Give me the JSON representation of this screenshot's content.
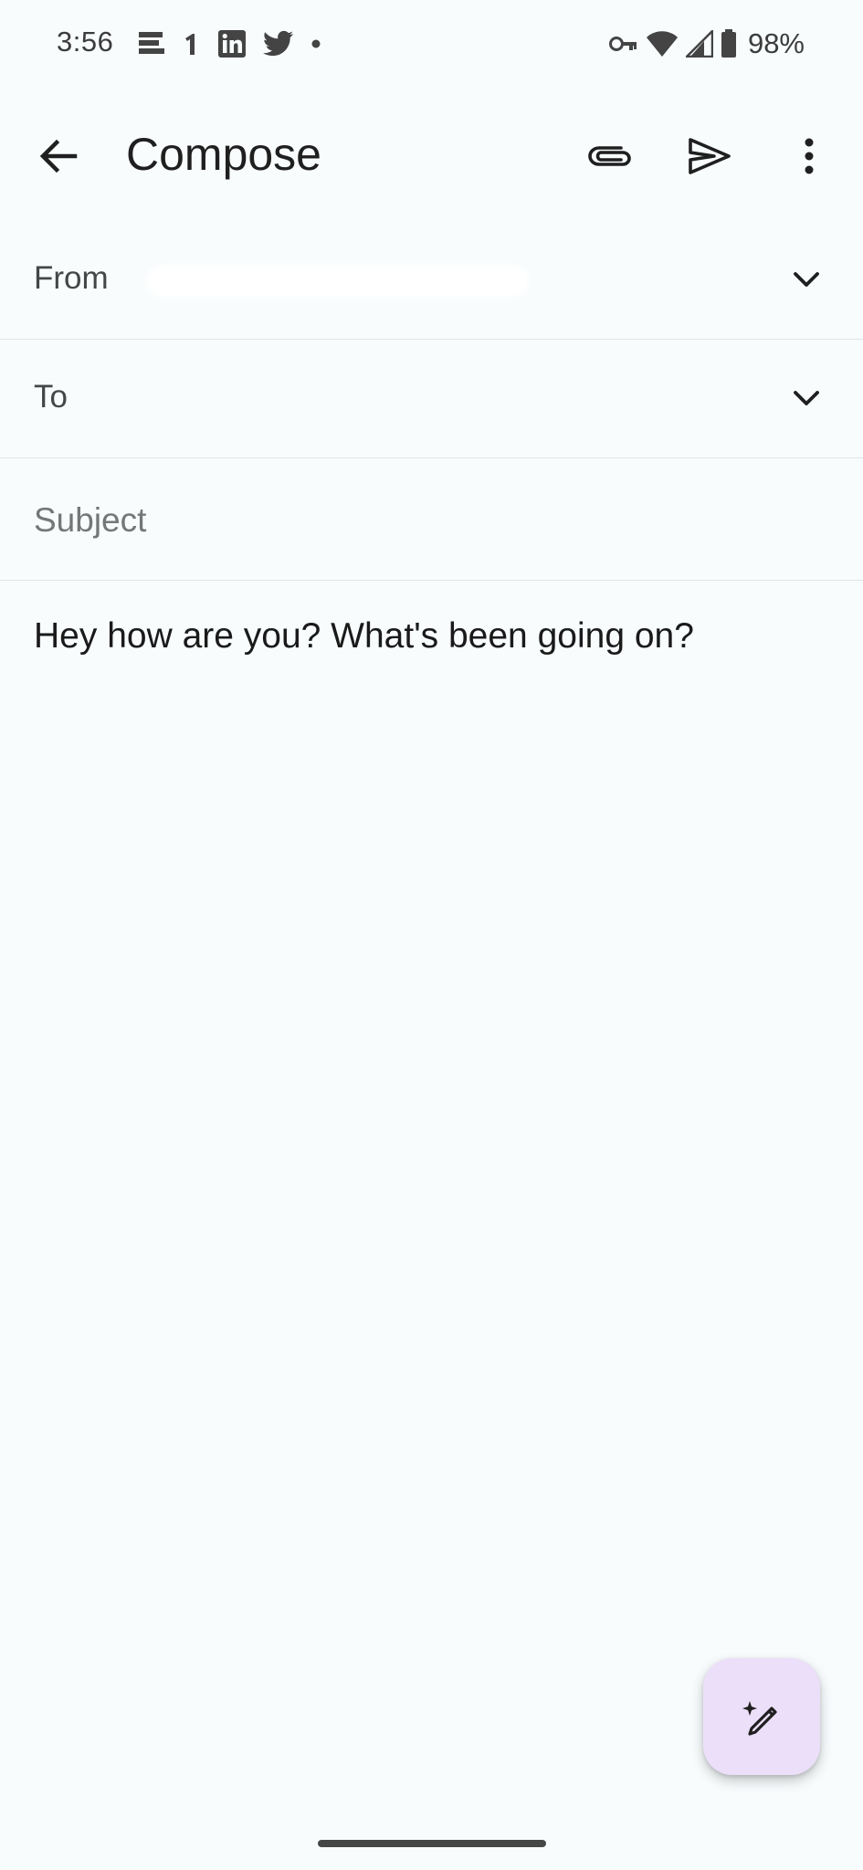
{
  "status_bar": {
    "time": "3:56",
    "battery": "98%",
    "left_icons": [
      "news-icon",
      "one-icon",
      "linkedin-icon",
      "twitter-icon",
      "dot-icon"
    ],
    "right_icons": [
      "vpn-key-icon",
      "wifi-icon",
      "signal-icon",
      "battery-icon"
    ]
  },
  "app_bar": {
    "title": "Compose",
    "actions": [
      "attach-icon",
      "send-icon",
      "more-vert-icon"
    ]
  },
  "fields": {
    "from_label": "From",
    "to_label": "To",
    "subject_placeholder": "Subject",
    "subject_value": ""
  },
  "body": {
    "text": "Hey how are you? What's been going on?"
  },
  "fab": {
    "icon": "magic-pencil-icon",
    "color": "#ebdff9"
  },
  "colors": {
    "background": "#f8fcfd",
    "divider": "#e3e6e8",
    "label": "#444746",
    "placeholder": "#747775"
  }
}
